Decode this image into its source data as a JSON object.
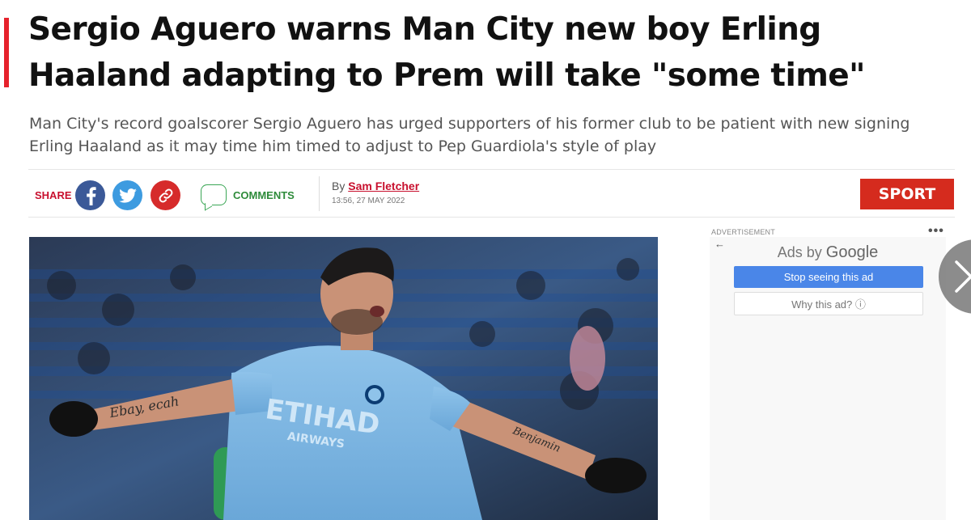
{
  "article": {
    "headline": "Sergio Aguero warns Man City new boy Erling Haaland adapting to Prem will take \"some time\"",
    "standfirst": "Man City's record goalscorer Sergio Aguero has urged supporters of his former club to be patient with new signing Erling Haaland as it may time him timed to adjust to Pep Guardiola's style of play",
    "accent_color": "#e6222c"
  },
  "meta": {
    "share_label": "SHARE",
    "share_icons": [
      "facebook-icon",
      "twitter-icon",
      "link-icon"
    ],
    "comments_label": "COMMENTS",
    "by_label": "By",
    "author": "Sam Fletcher",
    "timestamp": "13:56, 27 MAY 2022",
    "section": "SPORT",
    "section_color": "#d52b1e"
  },
  "hero": {
    "shirt_sponsor": "ETIHAD",
    "shirt_sponsor_sub": "AIRWAYS",
    "tattoo_left": "Ebay, ecah",
    "tattoo_right": "Benjamin"
  },
  "ad": {
    "label": "ADVERTISEMENT",
    "menu": "•••",
    "back": "←",
    "ads_by": "Ads by",
    "google": "Google",
    "stop_label": "Stop seeing this ad",
    "why_label": "Why this ad? ⓘ"
  },
  "nav": {
    "next_icon": "chevron-right-icon"
  }
}
